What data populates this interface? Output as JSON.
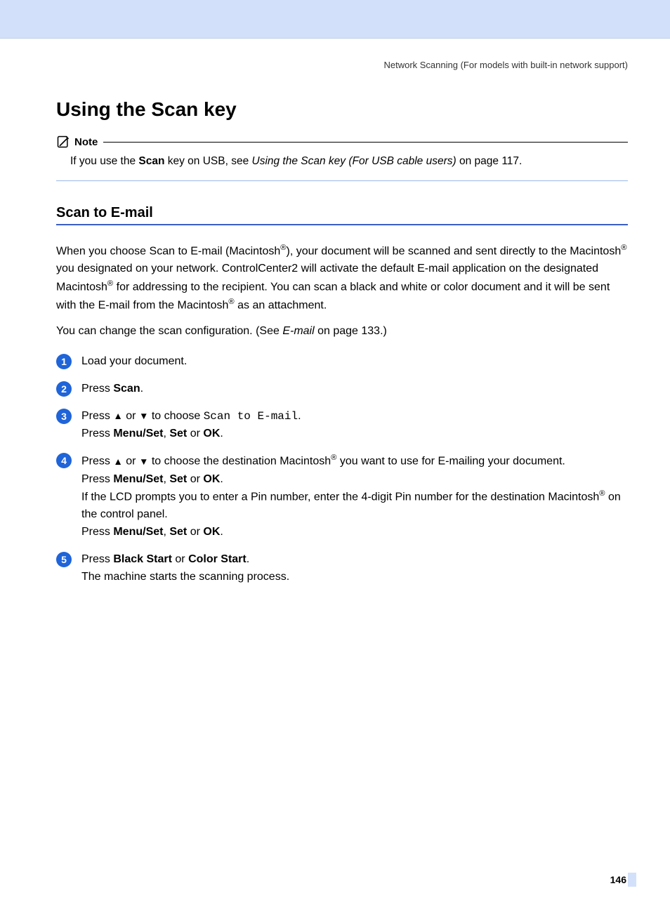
{
  "header": {
    "right_text": "Network Scanning (For models with built-in network support)"
  },
  "title": "Using the Scan key",
  "note": {
    "label": "Note",
    "text_before": "If you use the ",
    "bold": "Scan",
    "text_mid": " key on USB, see ",
    "italic": "Using the Scan key (For USB cable users)",
    "text_after": " on page 117."
  },
  "section_title": "Scan to E-mail",
  "para1": {
    "p1a": "When you choose Scan to E-mail (Macintosh",
    "p1b": "), your document will be scanned and sent directly to the Macintosh",
    "p1c": " you designated on your network. ControlCenter2 will activate the default E-mail application on the designated Macintosh",
    "p1d": " for addressing to the recipient. You can scan a black and white or color document and it will be sent with the E-mail from the Macintosh",
    "p1e": " as an attachment."
  },
  "para2": {
    "a": "You can change the scan configuration. (See ",
    "italic": "E-mail",
    "b": " on page 133.)"
  },
  "steps": [
    {
      "num": "1"
    },
    {
      "num": "2"
    },
    {
      "num": "3"
    },
    {
      "num": "4"
    },
    {
      "num": "5"
    }
  ],
  "step1": "Load your document.",
  "step2": {
    "a": "Press ",
    "b": "Scan",
    "c": "."
  },
  "step3": {
    "l1a": "Press ",
    "l1b": " or ",
    "l1c": " to choose ",
    "mono": "Scan to E-mail",
    "l1d": ".",
    "l2a": "Press ",
    "l2b": "Menu/Set",
    "l2c": ", ",
    "l2d": "Set",
    "l2e": " or ",
    "l2f": "OK",
    "l2g": "."
  },
  "step4": {
    "l1a": "Press ",
    "l1b": " or ",
    "l1c": " to choose the destination Macintosh",
    "l1d": " you want to use for E-mailing your document.",
    "l2a": "Press ",
    "l2b": "Menu/Set",
    "l2c": ", ",
    "l2d": "Set",
    "l2e": " or ",
    "l2f": "OK",
    "l2g": ".",
    "l3a": "If the LCD prompts you to enter a Pin number, enter the 4-digit Pin number for the destination Macintosh",
    "l3b": " on the control panel.",
    "l4a": "Press ",
    "l4b": "Menu/Set",
    "l4c": ", ",
    "l4d": "Set",
    "l4e": " or ",
    "l4f": "OK",
    "l4g": "."
  },
  "step5": {
    "l1a": "Press ",
    "l1b": "Black Start",
    "l1c": " or ",
    "l1d": "Color Start",
    "l1e": ".",
    "l2": "The machine starts the scanning process."
  },
  "page_number": "146",
  "reg": "®"
}
